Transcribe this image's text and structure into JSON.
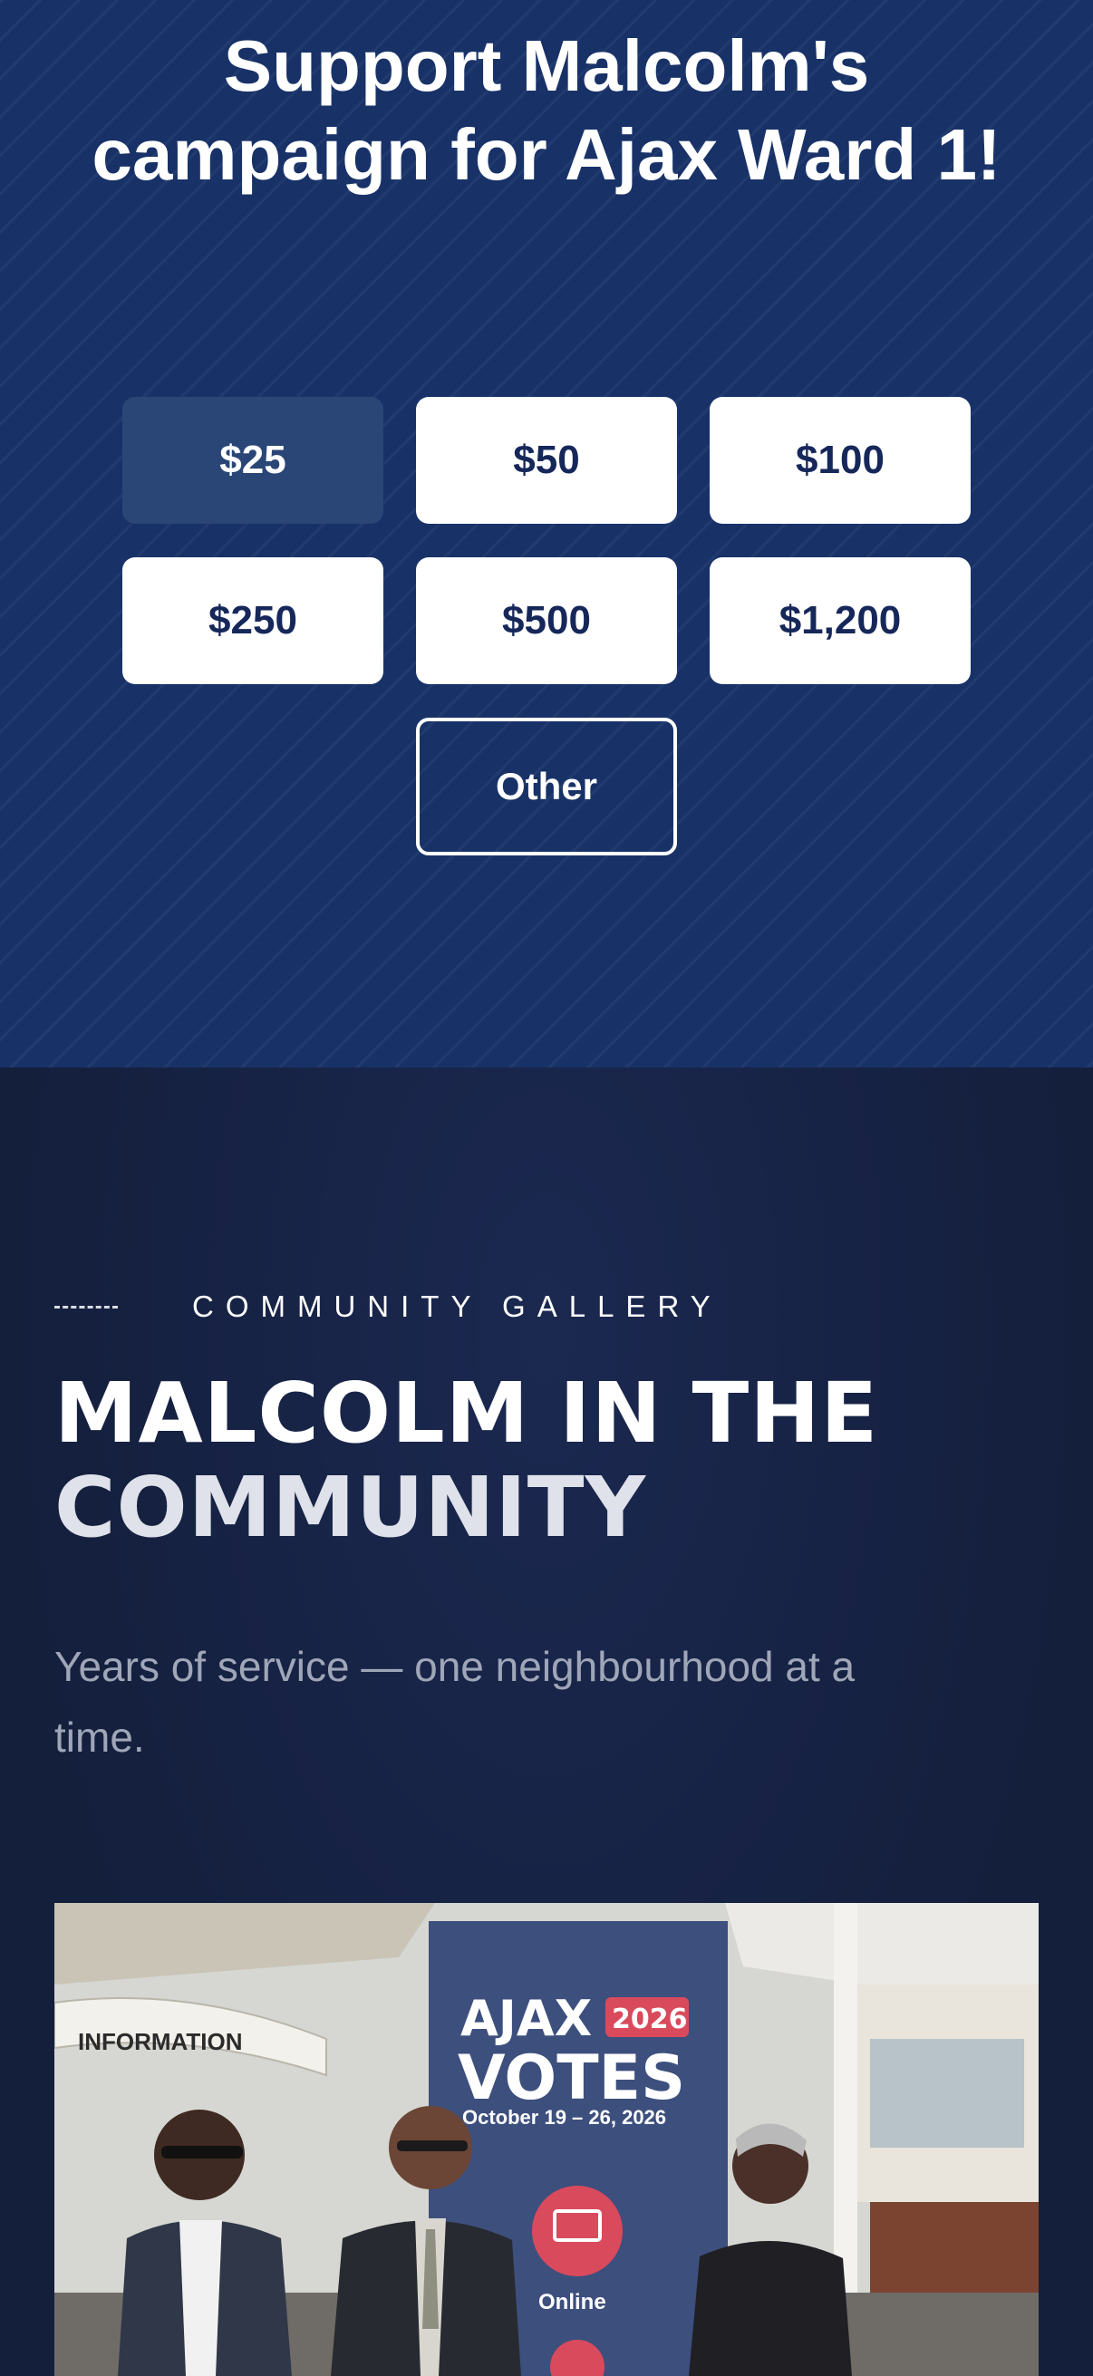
{
  "donation": {
    "title": "Support Malcolm's campaign for Ajax Ward 1!",
    "amounts": [
      "$25",
      "$50",
      "$100",
      "$250",
      "$500",
      "$1,200"
    ],
    "selected": "$25",
    "other_label": "Other"
  },
  "gallery": {
    "eyebrow": "COMMUNITY GALLERY",
    "heading_line1": "MALCOLM IN THE",
    "heading_line2": "COMMUNITY",
    "subtitle": "Years of service — one neighbourhood at a time.",
    "photo": {
      "banner_line1": "AJAX",
      "banner_year": "2026",
      "banner_line2": "VOTES",
      "banner_dates": "October 19 – 26, 2026",
      "banner_online": "Online",
      "sign_text": "INFORMATION"
    }
  },
  "colors": {
    "donate_bg": "#183268",
    "selected_bg": "#2a4677",
    "button_text": "#16275a",
    "gallery_bg": "#141f3c",
    "banner_red": "#d94a5c"
  }
}
